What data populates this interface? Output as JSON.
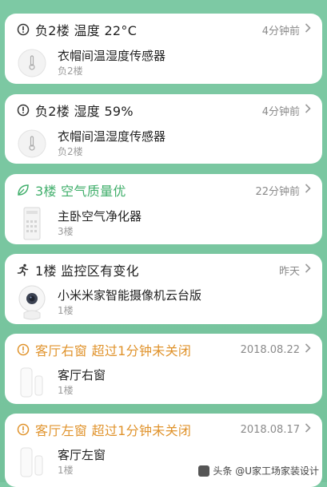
{
  "cards": [
    {
      "title": "负2楼 温度 22°C",
      "time": "4分钟前",
      "device": "衣帽间温湿度传感器",
      "location": "负2楼",
      "icon": "alert-circle-icon",
      "device_icon": "thermometer-sensor-icon",
      "accent": "#222222"
    },
    {
      "title": "负2楼 湿度 59%",
      "time": "4分钟前",
      "device": "衣帽间温湿度传感器",
      "location": "负2楼",
      "icon": "alert-circle-icon",
      "device_icon": "thermometer-sensor-icon",
      "accent": "#222222"
    },
    {
      "title": "3楼 空气质量优",
      "time": "22分钟前",
      "device": "主卧空气净化器",
      "location": "3楼",
      "icon": "leaf-icon",
      "device_icon": "air-purifier-icon",
      "accent": "#3fae6a"
    },
    {
      "title": "1楼 监控区有变化",
      "time": "昨天",
      "device": "小米米家智能摄像机云台版",
      "location": "1楼",
      "icon": "running-person-icon",
      "device_icon": "camera-icon",
      "accent": "#222222"
    },
    {
      "title": "客厅右窗 超过1分钟未关闭",
      "time": "2018.08.22",
      "device": "客厅右窗",
      "location": "1楼",
      "icon": "alert-circle-icon",
      "device_icon": "door-window-sensor-icon",
      "accent": "#e0932c"
    },
    {
      "title": "客厅左窗 超过1分钟未关闭",
      "time": "2018.08.17",
      "device": "客厅左窗",
      "location": "1楼",
      "icon": "alert-circle-icon",
      "device_icon": "door-window-sensor-icon",
      "accent": "#e0932c"
    }
  ],
  "watermark": "头条 @U家工场家装设计"
}
